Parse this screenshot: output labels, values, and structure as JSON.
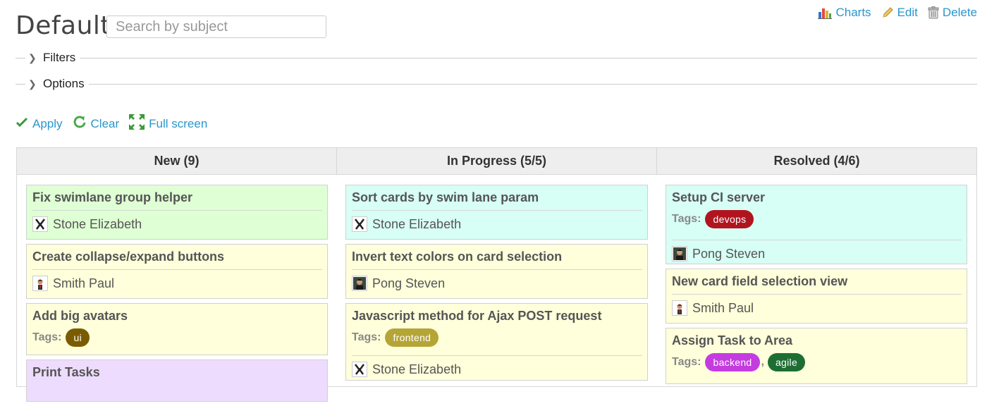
{
  "header": {
    "title": "Default",
    "search_placeholder": "Search by subject",
    "actions": [
      {
        "label": "Charts",
        "icon": "chart-icon"
      },
      {
        "label": "Edit",
        "icon": "pencil-icon"
      },
      {
        "label": "Delete",
        "icon": "trash-icon"
      }
    ]
  },
  "fieldsets": {
    "filters": "Filters",
    "options": "Options"
  },
  "buttons": {
    "apply": "Apply",
    "clear": "Clear",
    "fullscreen": "Full screen"
  },
  "colors": {
    "link": "#2996cc",
    "card_green": "#dfffd4",
    "card_yellow": "#ffffdb",
    "card_cyan": "#d7fff5",
    "card_purple": "#eedcff",
    "tag_ui": "#7a5c00",
    "tag_frontend": "#b5a536",
    "tag_devops": "#b0151f",
    "tag_backend": "#c43ce0",
    "tag_agile": "#1e6e33"
  },
  "board": {
    "columns": [
      {
        "title": "New (9)",
        "cards": [
          {
            "title": "Fix swimlane group helper",
            "color": "#dfffd4",
            "user": "Stone Elizabeth",
            "avatar": "avatar-elizabeth"
          },
          {
            "title": "Create collapse/expand buttons",
            "color": "#ffffdb",
            "user": "Smith Paul",
            "avatar": "avatar-paul"
          },
          {
            "title": "Add big avatars",
            "color": "#ffffdb",
            "tags_label": "Tags:",
            "tags": [
              {
                "name": "ui",
                "color": "#7a5c00"
              }
            ]
          },
          {
            "title": "Print Tasks",
            "color": "#eedcff"
          }
        ]
      },
      {
        "title": "In Progress (5/5)",
        "cards": [
          {
            "title": "Sort cards by swim lane param",
            "color": "#d7fff5",
            "user": "Stone Elizabeth",
            "avatar": "avatar-elizabeth"
          },
          {
            "title": "Invert text colors on card selection",
            "color": "#ffffdb",
            "user": "Pong Steven",
            "avatar": "avatar-steven"
          },
          {
            "title": "Javascript method for Ajax POST request",
            "color": "#ffffdb",
            "tags_label": "Tags:",
            "tags": [
              {
                "name": "frontend",
                "color": "#b5a536"
              }
            ],
            "user": "Stone Elizabeth",
            "avatar": "avatar-elizabeth"
          }
        ]
      },
      {
        "title": "Resolved (4/6)",
        "cards": [
          {
            "title": "Setup CI server",
            "color": "#d7fff5",
            "tags_label": "Tags:",
            "tags": [
              {
                "name": "devops",
                "color": "#b0151f"
              }
            ],
            "user": "Pong Steven",
            "avatar": "avatar-steven"
          },
          {
            "title": "New card field selection view",
            "color": "#ffffdb",
            "user": "Smith Paul",
            "avatar": "avatar-paul"
          },
          {
            "title": "Assign Task to Area",
            "color": "#ffffdb",
            "tags_label": "Tags:",
            "tags": [
              {
                "name": "backend",
                "color": "#c43ce0"
              },
              {
                "name": "agile",
                "color": "#1e6e33"
              }
            ]
          }
        ]
      }
    ]
  }
}
